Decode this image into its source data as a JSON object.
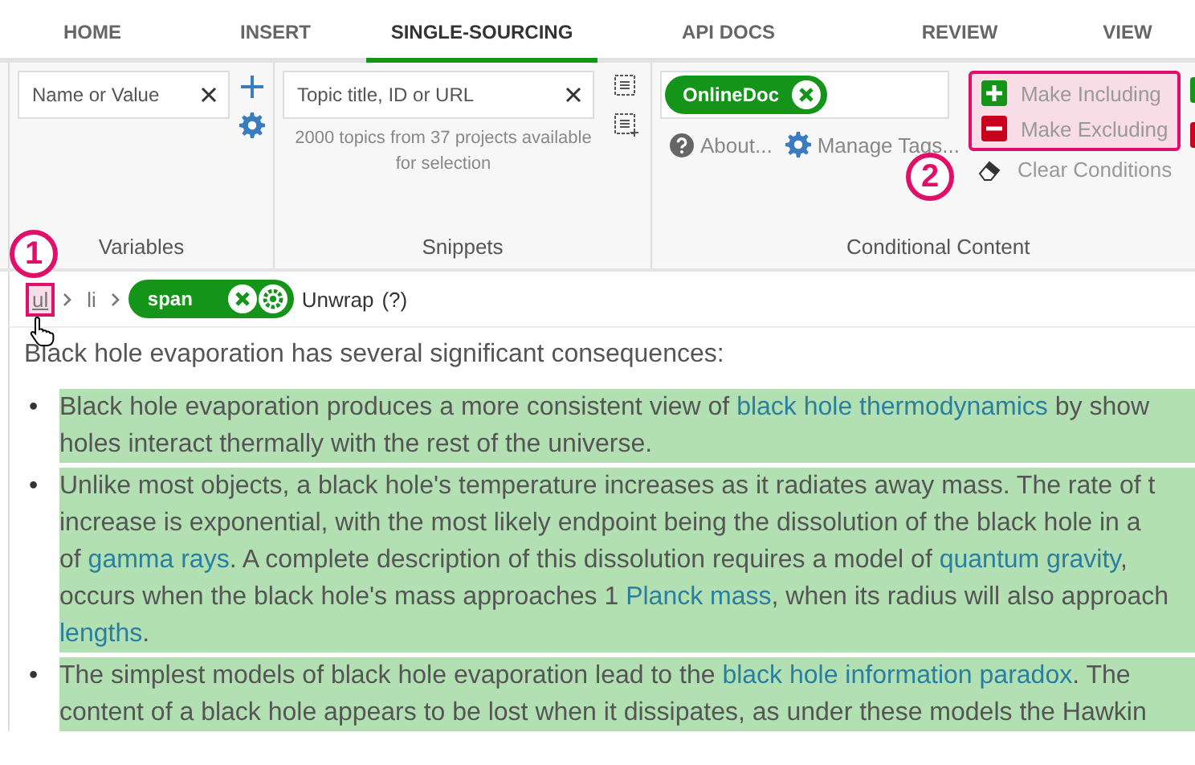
{
  "tabs": [
    {
      "label": "HOME",
      "selected": false
    },
    {
      "label": "INSERT",
      "selected": false
    },
    {
      "label": "SINGLE-SOURCING",
      "selected": true
    },
    {
      "label": "API DOCS",
      "selected": false
    },
    {
      "label": "REVIEW",
      "selected": false
    },
    {
      "label": "VIEW",
      "selected": false
    }
  ],
  "variables": {
    "search": {
      "placeholder": "Name or Value"
    },
    "label": "Variables"
  },
  "snippets": {
    "search": {
      "placeholder": "Topic title, ID or URL"
    },
    "info": "2000 topics from 37 projects available for selection",
    "label": "Snippets"
  },
  "conditional_content": {
    "tags": [
      "OnlineDoc"
    ],
    "about": "About...",
    "manage_tags": "Manage Tags...",
    "make_including": "Make Including",
    "make_excluding": "Make Excluding",
    "clear_conditions": "Clear Conditions",
    "label": "Conditional Content",
    "highlighted": true,
    "callout": "2"
  },
  "breadcrumb": {
    "callout": "1",
    "items": [
      {
        "label": "ul",
        "kind": "link",
        "highlighted": true
      },
      {
        "label": "li",
        "kind": "link",
        "highlighted": false
      },
      {
        "label": "span",
        "kind": "tag"
      }
    ],
    "unwrap": "Unwrap",
    "help": "(?)"
  },
  "intro": "Black hole evaporation has several significant consequences:",
  "bullets": [
    {
      "marker": "•",
      "lines": [
        [
          {
            "kind": "text",
            "text": "Black hole evaporation produces a more consistent view of "
          },
          {
            "kind": "link",
            "text": "black hole thermodynamics"
          },
          {
            "kind": "text",
            "text": " by show"
          }
        ],
        [
          {
            "kind": "text",
            "text": "holes interact thermally with the rest of the universe."
          }
        ]
      ]
    },
    {
      "marker": "•",
      "lines": [
        [
          {
            "kind": "text",
            "text": "Unlike most objects, a black hole's temperature increases as it radiates away mass. The rate of t"
          }
        ],
        [
          {
            "kind": "text",
            "text": "increase is exponential, with the most likely endpoint being the dissolution of the black hole in a"
          }
        ],
        [
          {
            "kind": "text",
            "text": "of "
          },
          {
            "kind": "link",
            "text": "gamma rays"
          },
          {
            "kind": "text",
            "text": ". A complete description of this dissolution requires a model of "
          },
          {
            "kind": "link",
            "text": "quantum gravity"
          },
          {
            "kind": "text",
            "text": ","
          }
        ],
        [
          {
            "kind": "text",
            "text": "occurs when the black hole's mass approaches 1 "
          },
          {
            "kind": "link",
            "text": "Planck mass"
          },
          {
            "kind": "text",
            "text": ", when its radius will also approach"
          }
        ],
        [
          {
            "kind": "link",
            "text": "lengths"
          },
          {
            "kind": "text",
            "text": "."
          }
        ]
      ]
    },
    {
      "marker": "•",
      "lines": [
        [
          {
            "kind": "text",
            "text": "The simplest models of black hole evaporation lead to the "
          },
          {
            "kind": "link",
            "text": "black hole information paradox"
          },
          {
            "kind": "text",
            "text": ". The"
          }
        ],
        [
          {
            "kind": "text",
            "text": "content of a black hole appears to be lost when it dissipates, as under these models the Hawkin"
          }
        ]
      ]
    }
  ]
}
